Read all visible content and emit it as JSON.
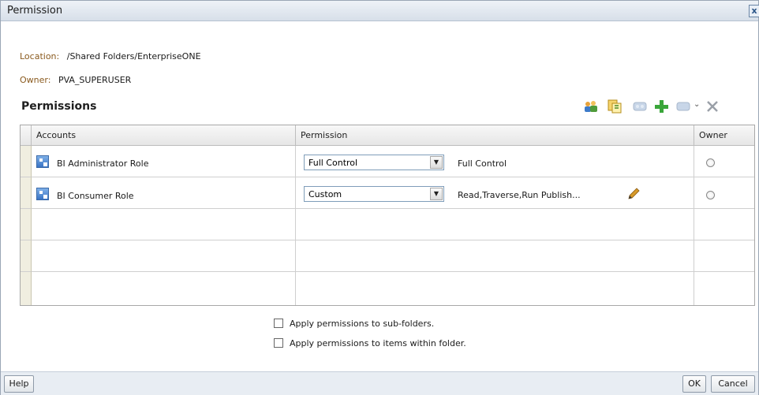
{
  "dialog": {
    "title": "Permission"
  },
  "location": {
    "label": "Location:",
    "value": "/Shared Folders/EnterpriseONE"
  },
  "owner": {
    "label": "Owner:",
    "value": "PVA_SUPERUSER"
  },
  "permissions_section": {
    "title": "Permissions"
  },
  "toolbar": {
    "icons": [
      "add-users-roles-icon",
      "copy-permissions-icon",
      "paste-permissions-icon",
      "add-icon",
      "more-actions-icon",
      "delete-icon"
    ]
  },
  "table": {
    "columns": [
      "Accounts",
      "Permission",
      "Owner"
    ],
    "rows": [
      {
        "account": "BI Administrator Role",
        "permission": "Full Control",
        "description": "Full Control",
        "editable": false
      },
      {
        "account": "BI Consumer Role",
        "permission": "Custom",
        "description": "Read,Traverse,Run Publish...",
        "editable": true
      }
    ]
  },
  "options": {
    "apply_subfolders": "Apply permissions to sub-folders.",
    "apply_items": "Apply permissions to items within folder."
  },
  "footer": {
    "help": "Help",
    "ok": "OK",
    "cancel": "Cancel"
  }
}
